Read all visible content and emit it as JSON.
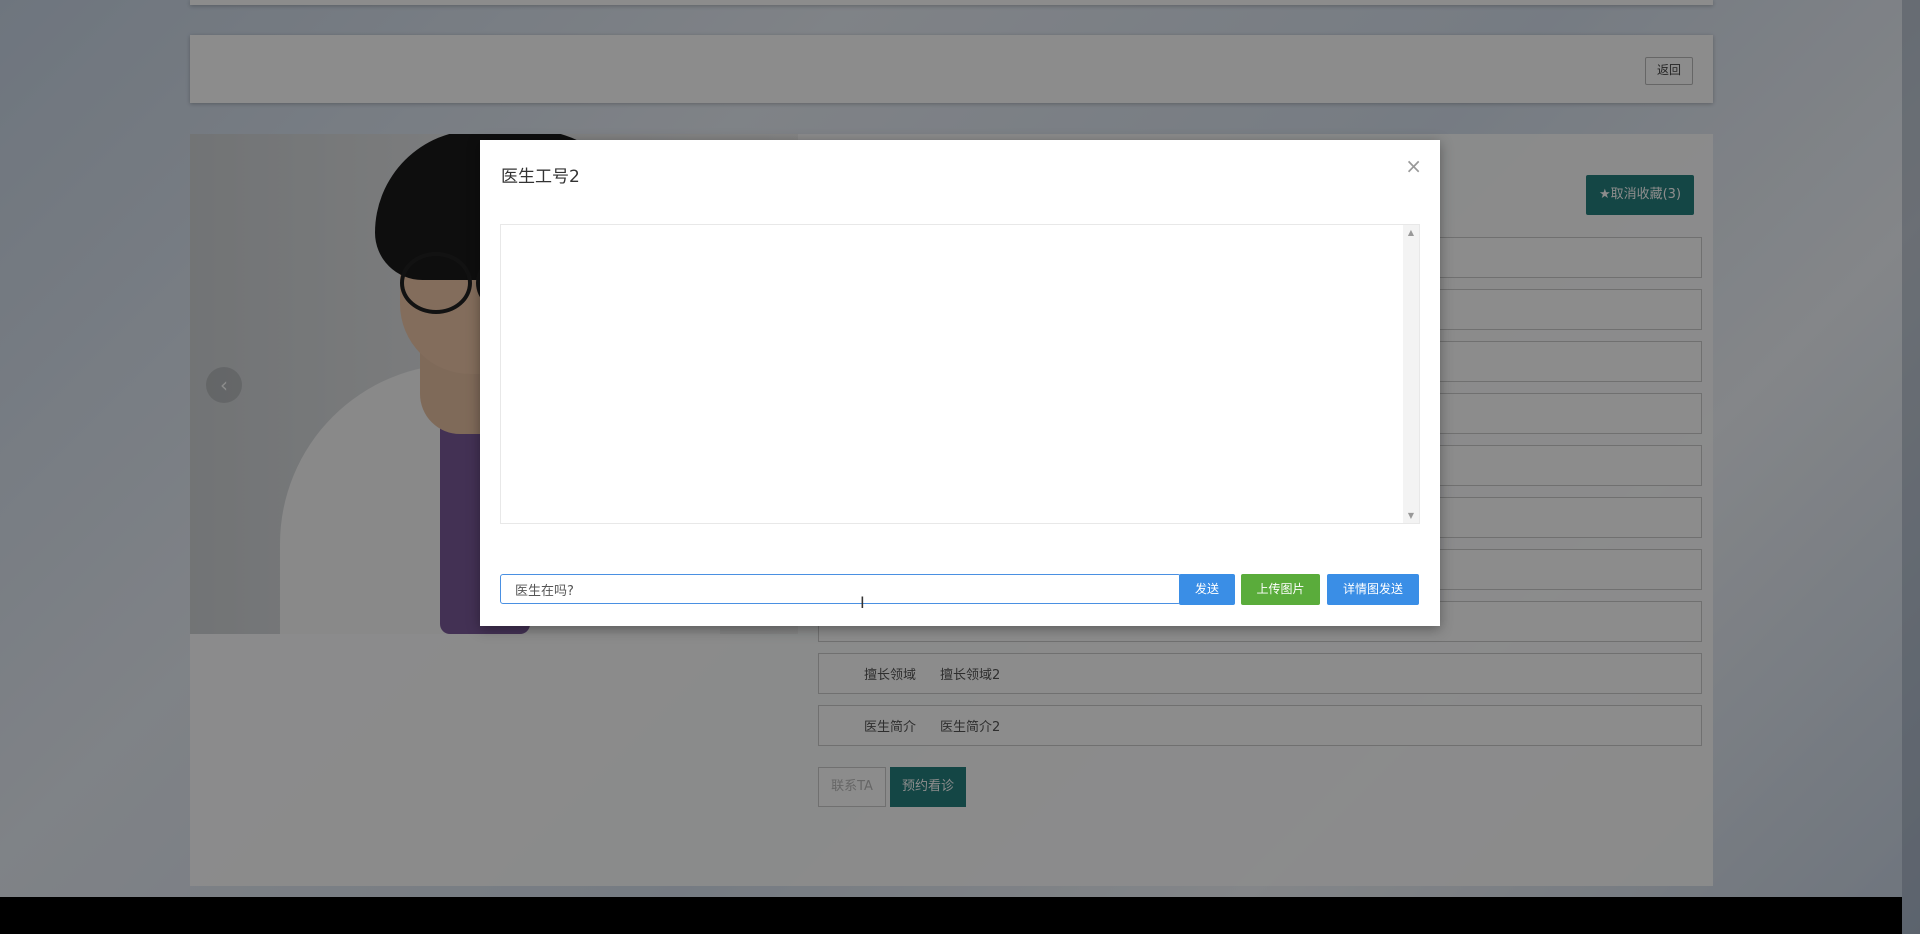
{
  "action_bar": {
    "back_label": "返回"
  },
  "detail": {
    "favorite_label": "★取消收藏(3)",
    "rows": [
      {
        "label": "",
        "value": ""
      },
      {
        "label": "",
        "value": ""
      },
      {
        "label": "",
        "value": ""
      },
      {
        "label": "",
        "value": ""
      },
      {
        "label": "",
        "value": ""
      },
      {
        "label": "",
        "value": ""
      },
      {
        "label": "",
        "value": ""
      },
      {
        "label": "",
        "value": ""
      },
      {
        "label": "擅长领域",
        "value": "擅长领域2"
      },
      {
        "label": "医生简介",
        "value": "医生简介2"
      }
    ],
    "contact_label": "联系TA",
    "book_label": "预约看诊"
  },
  "dialog": {
    "title": "医生工号2",
    "close_icon": "×",
    "input_value": "医生在吗?",
    "send_label": "发送",
    "upload_label": "上传图片",
    "detail_send_label": "详情图发送"
  }
}
